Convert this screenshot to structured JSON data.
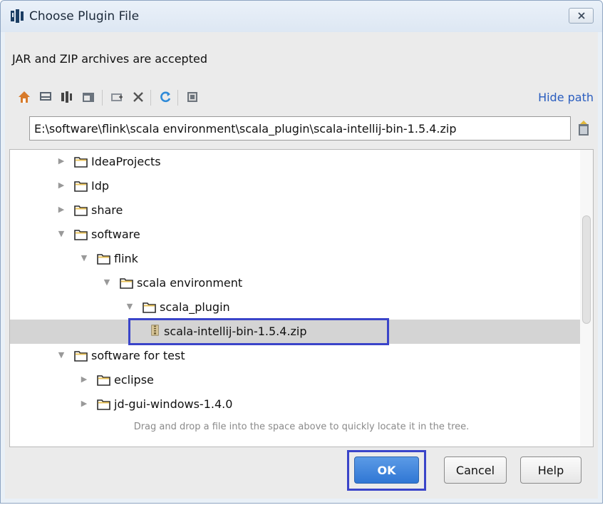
{
  "window": {
    "title": "Choose Plugin File"
  },
  "description": "JAR and ZIP archives are accepted",
  "toolbar": {
    "icons": [
      "home-icon",
      "desktop-icon",
      "project-icon",
      "module-icon",
      "new-folder-icon",
      "delete-icon",
      "refresh-icon",
      "show-hidden-icon"
    ],
    "hide_path": "Hide path"
  },
  "path": {
    "value": "E:\\software\\flink\\scala environment\\scala_plugin\\scala-intellij-bin-1.5.4.zip"
  },
  "tree": {
    "items": [
      {
        "label": "IdeaProjects",
        "level": 0,
        "expanded": false,
        "type": "folder"
      },
      {
        "label": "Idp",
        "level": 0,
        "expanded": false,
        "type": "folder"
      },
      {
        "label": "share",
        "level": 0,
        "expanded": false,
        "type": "folder"
      },
      {
        "label": "software",
        "level": 0,
        "expanded": true,
        "type": "folder"
      },
      {
        "label": "flink",
        "level": 1,
        "expanded": true,
        "type": "folder"
      },
      {
        "label": "scala environment",
        "level": 2,
        "expanded": true,
        "type": "folder"
      },
      {
        "label": "scala_plugin",
        "level": 3,
        "expanded": true,
        "type": "folder"
      },
      {
        "label": "scala-intellij-bin-1.5.4.zip",
        "level": 4,
        "expanded": null,
        "type": "archive",
        "selected": true
      },
      {
        "label": "software for test",
        "level": 0,
        "expanded": true,
        "type": "folder"
      },
      {
        "label": "eclipse",
        "level": 1,
        "expanded": false,
        "type": "folder"
      },
      {
        "label": "jd-gui-windows-1.4.0",
        "level": 1,
        "expanded": false,
        "type": "folder"
      }
    ]
  },
  "hint": "Drag and drop a file into the space above to quickly locate it in the tree.",
  "buttons": {
    "ok": "OK",
    "cancel": "Cancel",
    "help": "Help"
  },
  "colors": {
    "accent": "#3077d4",
    "folder": "#e8c25a",
    "highlight": "#3a44c9"
  }
}
